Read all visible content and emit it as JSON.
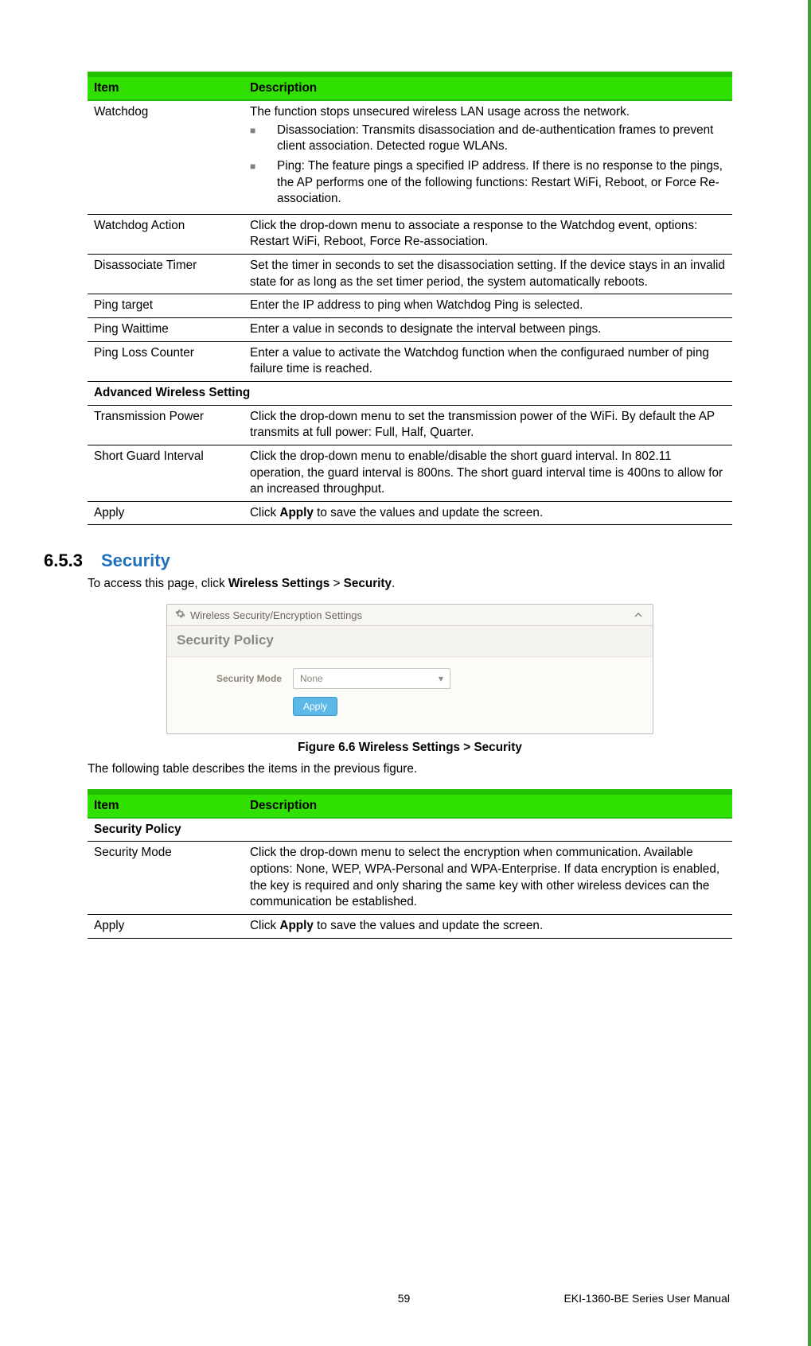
{
  "table1": {
    "headers": [
      "Item",
      "Description"
    ],
    "rows": [
      {
        "item": "Watchdog",
        "desc_intro": "The function stops unsecured wireless LAN usage across the network.",
        "bullets": [
          "Disassociation: Transmits disassociation and de-authentication frames to prevent client association. Detected rogue WLANs.",
          "Ping: The feature pings a specified IP address. If there is no response to the pings, the AP performs one of the following functions: Restart WiFi, Reboot, or Force Re-association."
        ]
      },
      {
        "item": "Watchdog Action",
        "desc": "Click the drop-down menu to associate a response to the Watchdog event, options: Restart WiFi, Reboot, Force Re-association."
      },
      {
        "item": "Disassociate Timer",
        "desc": "Set the timer in seconds to set the disassociation setting. If the device stays in an invalid state for as long as the set timer period, the system automatically reboots."
      },
      {
        "item": "Ping target",
        "desc": "Enter the IP address to ping when Watchdog Ping is selected."
      },
      {
        "item": "Ping Waittime",
        "desc": "Enter a value in seconds to designate the interval between pings."
      },
      {
        "item": "Ping Loss Counter",
        "desc": "Enter a value to activate the Watchdog function when the configuraed number of ping failure time is reached."
      }
    ],
    "section2_head": "Advanced Wireless Setting",
    "rows2": [
      {
        "item": "Transmission Power",
        "desc": "Click the drop-down menu to set the transmission power of the WiFi. By default the AP transmits at full power: Full, Half, Quarter."
      },
      {
        "item": "Short Guard Interval",
        "desc": "Click the drop-down menu to enable/disable the short guard interval. In 802.11 operation, the guard interval is 800ns. The short guard interval time is 400ns to allow for an increased throughput."
      },
      {
        "item": "Apply",
        "desc_pre": "Click ",
        "desc_bold": "Apply",
        "desc_post": " to save the values and update the screen."
      }
    ]
  },
  "section": {
    "num": "6.5.3",
    "title": "Security",
    "intro_pre": "To access this page, click ",
    "intro_b1": "Wireless Settings",
    "intro_mid": " > ",
    "intro_b2": "Security",
    "intro_post": "."
  },
  "panel": {
    "title": "Wireless Security/Encryption Settings",
    "subtitle": "Security Policy",
    "label": "Security Mode",
    "selected": "None",
    "apply": "Apply"
  },
  "fig_caption": "Figure 6.6 Wireless Settings > Security",
  "post_fig": "The following table describes the items in the previous figure.",
  "table2": {
    "headers": [
      "Item",
      "Description"
    ],
    "section_head": "Security Policy",
    "rows": [
      {
        "item": "Security Mode",
        "desc": "Click the drop-down menu to select the encryption when communication. Available options: None, WEP, WPA-Personal and WPA-Enterprise. If data encryption is enabled, the key is required and only sharing the same key with other wireless devices can the communication be established."
      },
      {
        "item": "Apply",
        "desc_pre": "Click ",
        "desc_bold": "Apply",
        "desc_post": " to save the values and update the screen."
      }
    ]
  },
  "footer": {
    "page": "59",
    "title": "EKI-1360-BE Series User Manual"
  }
}
